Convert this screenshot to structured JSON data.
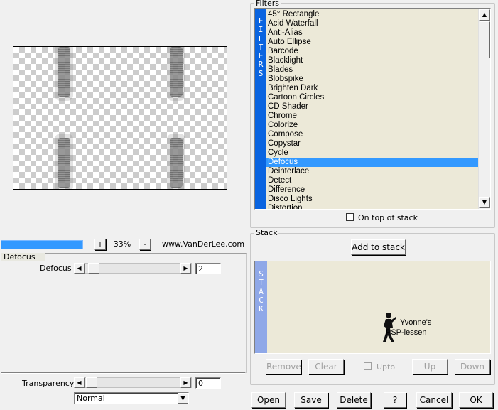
{
  "filters": {
    "legend": "Filters",
    "side_label": "FILTERS",
    "items": [
      "45° Rectangle",
      "Acid Waterfall",
      "Anti-Alias",
      "Auto Ellipse",
      "Barcode",
      "Blacklight",
      "Blades",
      "Blobspike",
      "Brighten Dark",
      "Cartoon Circles",
      "CD Shader",
      "Chrome",
      "Colorize",
      "Compose",
      "Copystar",
      "Cycle",
      "Defocus",
      "Deinterlace",
      "Detect",
      "Difference",
      "Disco Lights",
      "Distortion"
    ],
    "selected": "Defocus",
    "on_top_label": "On top of stack"
  },
  "stack": {
    "legend": "Stack",
    "side_label": "STACK",
    "add_label": "Add to stack",
    "watermark_line1": "Yvonne's",
    "watermark_line2": "PSP-lessen",
    "remove_label": "Remove",
    "clear_label": "Clear",
    "upto_label": "Upto",
    "up_label": "Up",
    "down_label": "Down"
  },
  "zoom": {
    "plus": "+",
    "value": "33%",
    "minus": "-",
    "link": "www.VanDerLee.com"
  },
  "defocus": {
    "tab_label": "Defocus",
    "param_label": "Defocus",
    "value": "2",
    "level_fraction": 0.02
  },
  "transparency": {
    "label": "Transparency",
    "value": "0",
    "blend_mode": "Normal"
  },
  "footer": {
    "open": "Open",
    "save": "Save",
    "delete": "Delete",
    "help": "?",
    "cancel": "Cancel",
    "ok": "OK"
  },
  "colors": {
    "filters_side": "#0a64e0",
    "stack_side": "#8fa8e8",
    "selection": "#3399ff",
    "list_bg": "#ece9d8"
  }
}
